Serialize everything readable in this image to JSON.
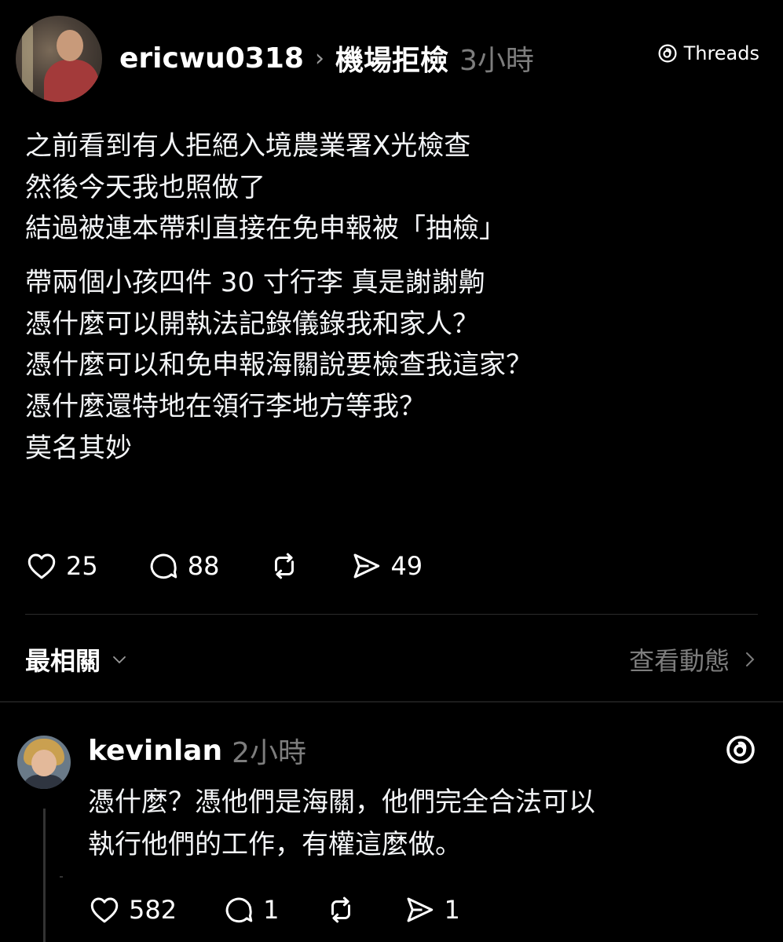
{
  "post": {
    "username": "ericwu0318",
    "separator": "›",
    "topic": "機場拒檢",
    "time": "3小時",
    "badge": "Threads",
    "lines_p1": [
      "之前看到有人拒絕入境農業署X光檢查",
      "然後今天我也照做了",
      "結過被連本帶利直接在免申報被「抽檢」"
    ],
    "lines_p2": [
      "帶兩個小孩四件 30 寸行李 真是謝謝齁",
      "憑什麼可以開執法記錄儀錄我和家人？",
      "憑什麼可以和免申報海關說要檢查我這家？",
      "憑什麼還特地在領行李地方等我？",
      "莫名其妙"
    ],
    "likes": "25",
    "comments": "88",
    "shares": "49"
  },
  "sort": {
    "label": "最相關",
    "view_activity": "查看動態"
  },
  "reply": {
    "username": "kevinlan",
    "time": "2小時",
    "lines": [
      "憑什麼？憑他們是海關，他們完全合法可以",
      "執行他們的工作，有權這麼做。"
    ],
    "likes": "582",
    "comments": "1",
    "shares": "1"
  },
  "icons": {
    "like": "heart-icon",
    "comment": "comment-icon",
    "repost": "repost-icon",
    "share": "share-icon",
    "threads": "threads-logo-icon"
  },
  "colors": {
    "background": "#000000",
    "text": "#f3f5f7",
    "muted": "#7d7d7d"
  }
}
